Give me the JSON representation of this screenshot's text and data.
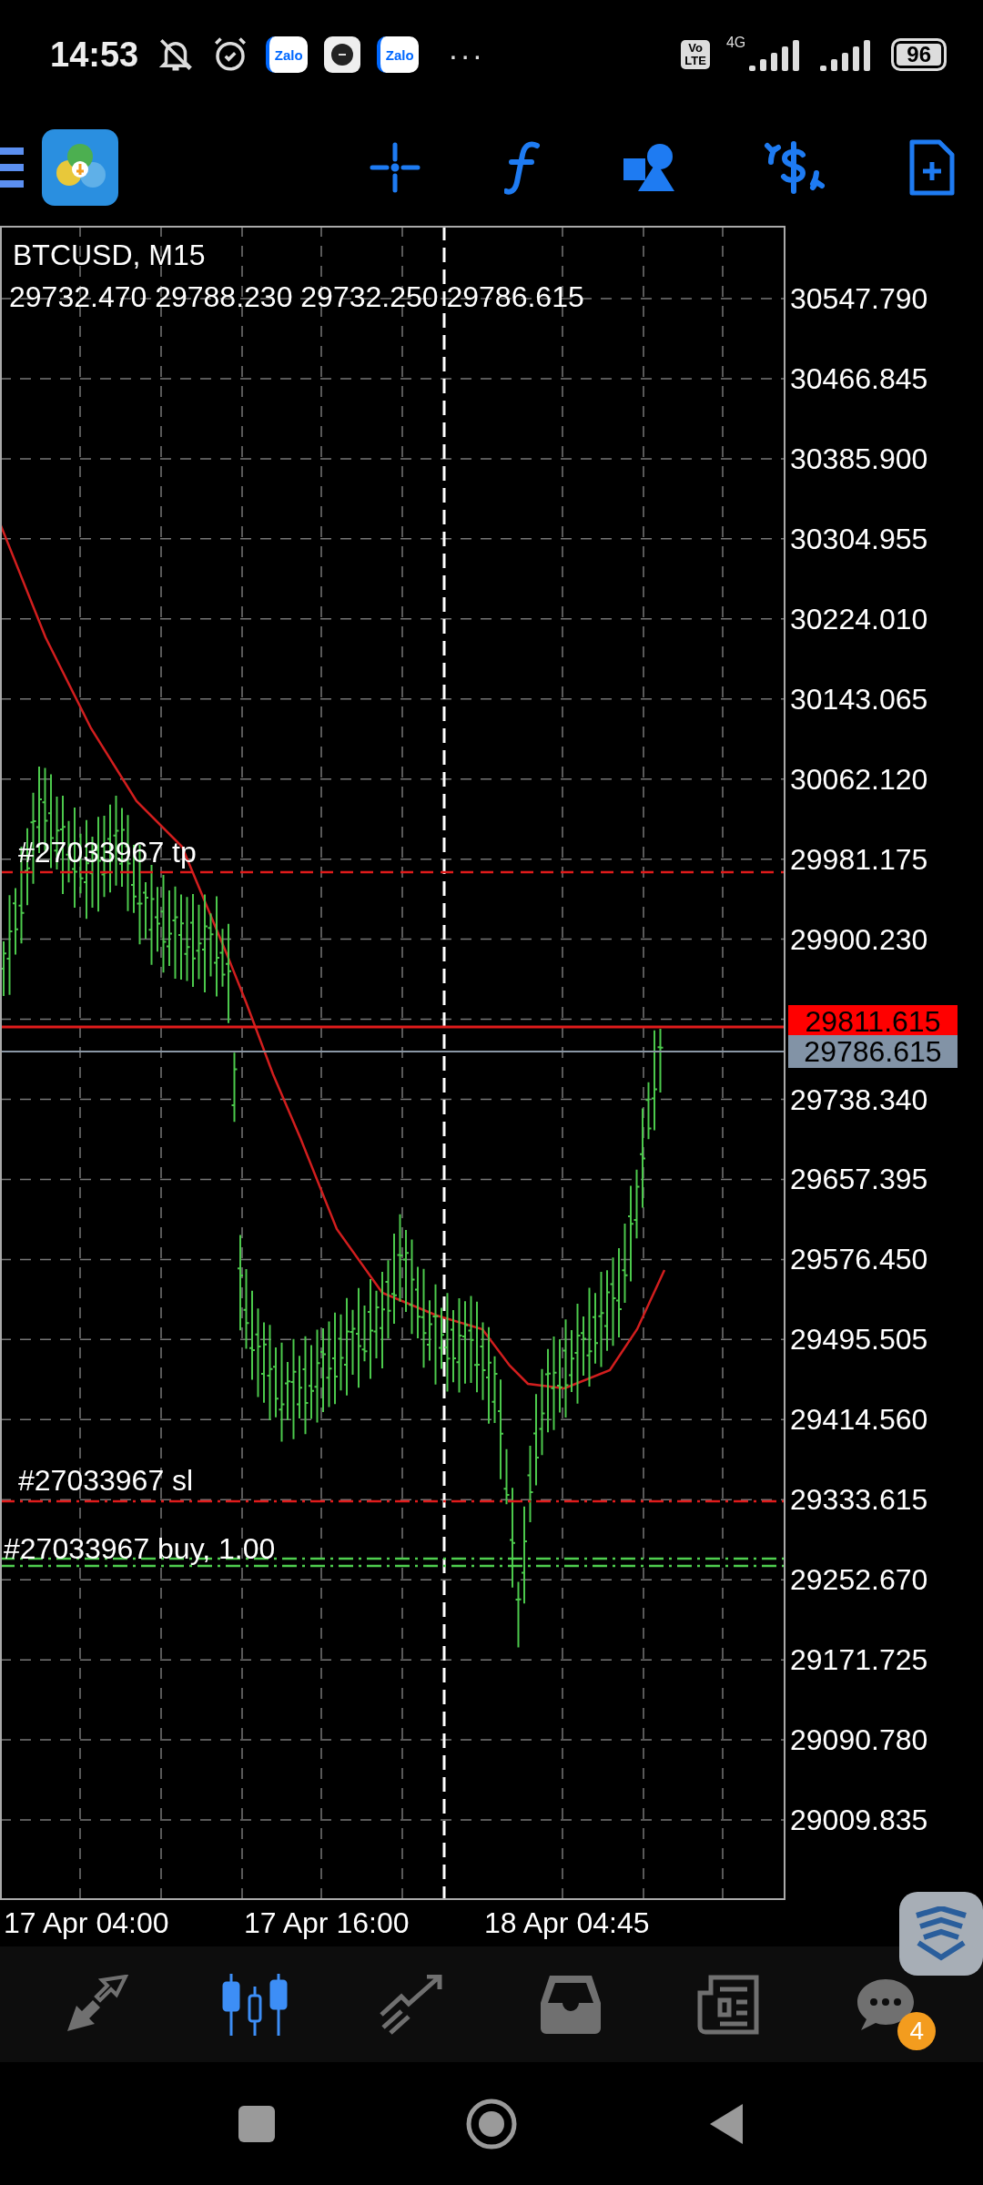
{
  "status_bar": {
    "time": "14:53",
    "icons": [
      {
        "kind": "muted"
      },
      {
        "kind": "alarm"
      },
      {
        "kind": "zalo",
        "label": "Zalo"
      },
      {
        "kind": "app"
      },
      {
        "kind": "zalo",
        "label": "Zalo"
      }
    ],
    "more": "···",
    "volte": [
      "Vo",
      "LTE"
    ],
    "network": "4G",
    "battery": "96"
  },
  "chart": {
    "symbol": "BTCUSD, M15",
    "ohlc": [
      "29732.470",
      "29788.230",
      "29732.250",
      "29786.615"
    ],
    "price_axis": [
      "30547.790",
      "30466.845",
      "30385.900",
      "30304.955",
      "30224.010",
      "30143.065",
      "30062.120",
      "29981.175",
      "29900.230",
      "29738.340",
      "29657.395",
      "29576.450",
      "29495.505",
      "29414.560",
      "29333.615",
      "29252.670",
      "29171.725",
      "29090.780",
      "29009.835"
    ],
    "ask": "29811.615",
    "bid": "29786.615",
    "orders": [
      {
        "kind": "tp",
        "label": "#27033967 tp"
      },
      {
        "kind": "sl",
        "label": "#27033967 sl"
      },
      {
        "kind": "buy",
        "label": "#27033967 buy, 1.00"
      }
    ],
    "time_axis": [
      "17 Apr 04:00",
      "17 Apr 16:00",
      "18 Apr 04:45"
    ]
  },
  "bottom_nav": [
    {
      "kind": "quotes",
      "selected": false
    },
    {
      "kind": "chart",
      "selected": true
    },
    {
      "kind": "trade",
      "selected": false
    },
    {
      "kind": "history",
      "selected": false
    },
    {
      "kind": "news",
      "selected": false
    },
    {
      "kind": "chat",
      "selected": false,
      "badge": "4"
    }
  ]
}
